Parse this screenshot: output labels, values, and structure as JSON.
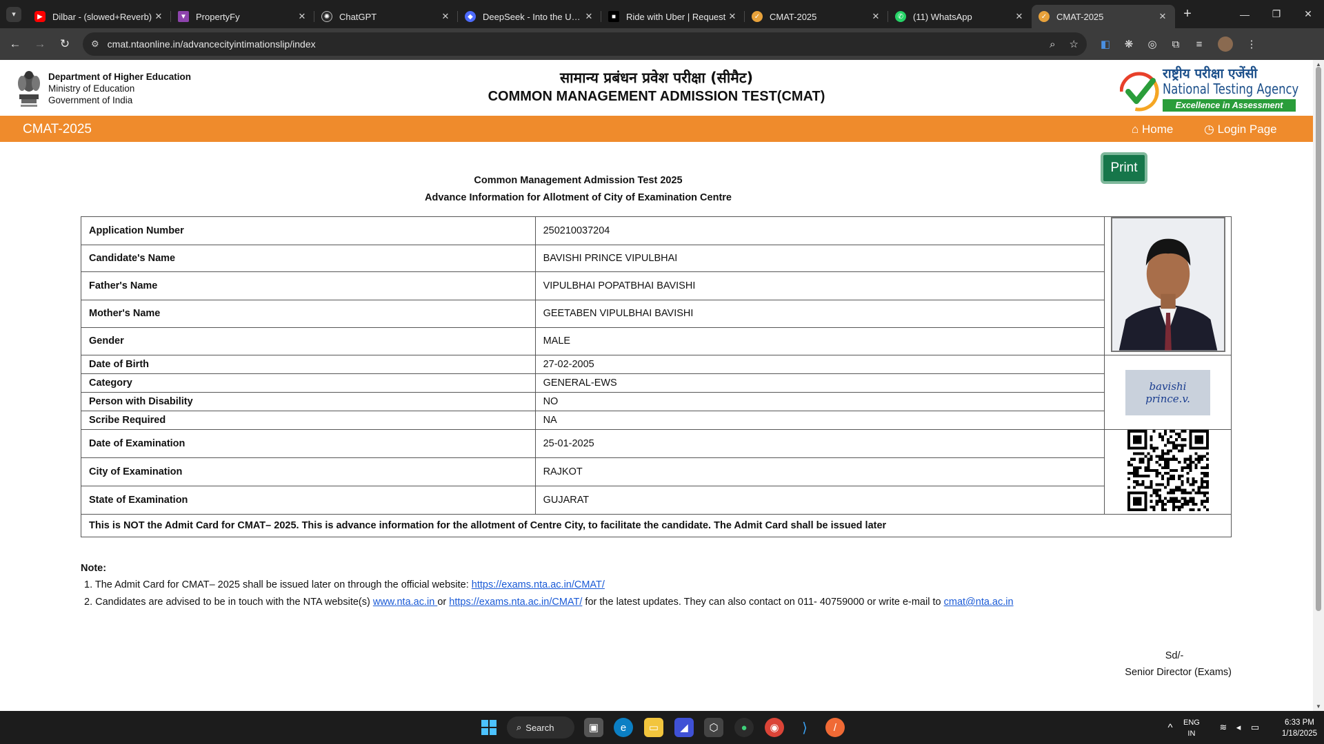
{
  "browser": {
    "tabs": [
      {
        "title": "Dilbar - (slowed+Reverb)",
        "fav_color": "#ff0000"
      },
      {
        "title": "PropertyFy",
        "fav_color": "#8e44ad"
      },
      {
        "title": "ChatGPT",
        "fav_color": "#2a2a2a"
      },
      {
        "title": "DeepSeek - Into the Unkn",
        "fav_color": "#4d6bfe"
      },
      {
        "title": "Ride with Uber | Request",
        "fav_color": "#000000"
      },
      {
        "title": "CMAT-2025",
        "fav_color": "#e8a23b"
      },
      {
        "title": "(11) WhatsApp",
        "fav_color": "#25d366"
      },
      {
        "title": "CMAT-2025",
        "fav_color": "#e8a23b"
      }
    ],
    "url": "cmat.ntaonline.in/advancecityintimationslip/index"
  },
  "header": {
    "dept_line1": "Department of Higher Education",
    "dept_line2": "Ministry of Education",
    "dept_line3": "Government of India",
    "title_hindi": "सामान्य प्रबंधन प्रवेश परीक्षा (सीमैट)",
    "title_english": "COMMON MANAGEMENT ADMISSION TEST(CMAT)",
    "nta_hindi": "राष्ट्रीय परीक्षा एजेंसी",
    "nta_english": "National Testing Agency",
    "nta_tagline": "Excellence in Assessment"
  },
  "navbar": {
    "brand": "CMAT-2025",
    "home": "Home",
    "login": "Login Page"
  },
  "print_label": "Print",
  "doc_title_1": "Common Management Admission Test 2025",
  "doc_title_2": "Advance Information for Allotment of City of Examination Centre",
  "rows": [
    {
      "label": "Application Number",
      "value": "250210037204"
    },
    {
      "label": "Candidate's Name",
      "value": "BAVISHI PRINCE VIPULBHAI"
    },
    {
      "label": "Father's Name",
      "value": "VIPULBHAI POPATBHAI BAVISHI"
    },
    {
      "label": "Mother's Name",
      "value": "GEETABEN VIPULBHAI BAVISHI"
    },
    {
      "label": "Gender",
      "value": "MALE"
    },
    {
      "label": "Date of Birth",
      "value": "27-02-2005"
    },
    {
      "label": "Category",
      "value": "GENERAL-EWS"
    },
    {
      "label": "Person with Disability",
      "value": "NO"
    },
    {
      "label": "Scribe Required",
      "value": "NA"
    },
    {
      "label": "Date of Examination",
      "value": "25-01-2025"
    },
    {
      "label": "City of Examination",
      "value": "RAJKOT"
    },
    {
      "label": "State of Examination",
      "value": "GUJARAT"
    }
  ],
  "signature_text": "bavishi prince.v.",
  "notice": "This is NOT the Admit Card for CMAT– 2025. This is advance information for the allotment of Centre City, to facilitate the candidate. The Admit Card shall be issued later",
  "note": {
    "heading": "Note:",
    "item1_prefix": "1. The Admit Card for CMAT– 2025 shall be issued later on through the official website: ",
    "item1_link": "https://exams.nta.ac.in/CMAT/",
    "item2_prefix": "2. Candidates are advised to be in touch with the NTA website(s) ",
    "item2_link1": "www.nta.ac.in ",
    "item2_or": " or ",
    "item2_link2": "https://exams.nta.ac.in/CMAT/",
    "item2_mid": " for the latest updates. They can also contact on 011- 40759000 or write e-mail to ",
    "item2_email": "cmat@nta.ac.in"
  },
  "signoff": {
    "line1": "Sd/-",
    "line2": "Senior Director (Exams)"
  },
  "taskbar": {
    "search": "Search",
    "lang1": "ENG",
    "lang2": "IN",
    "time": "6:33 PM",
    "date": "1/18/2025"
  },
  "colors": {
    "nav_orange": "#ef8b2c",
    "print_green": "#16764a",
    "link_blue": "#1a5ad6"
  }
}
